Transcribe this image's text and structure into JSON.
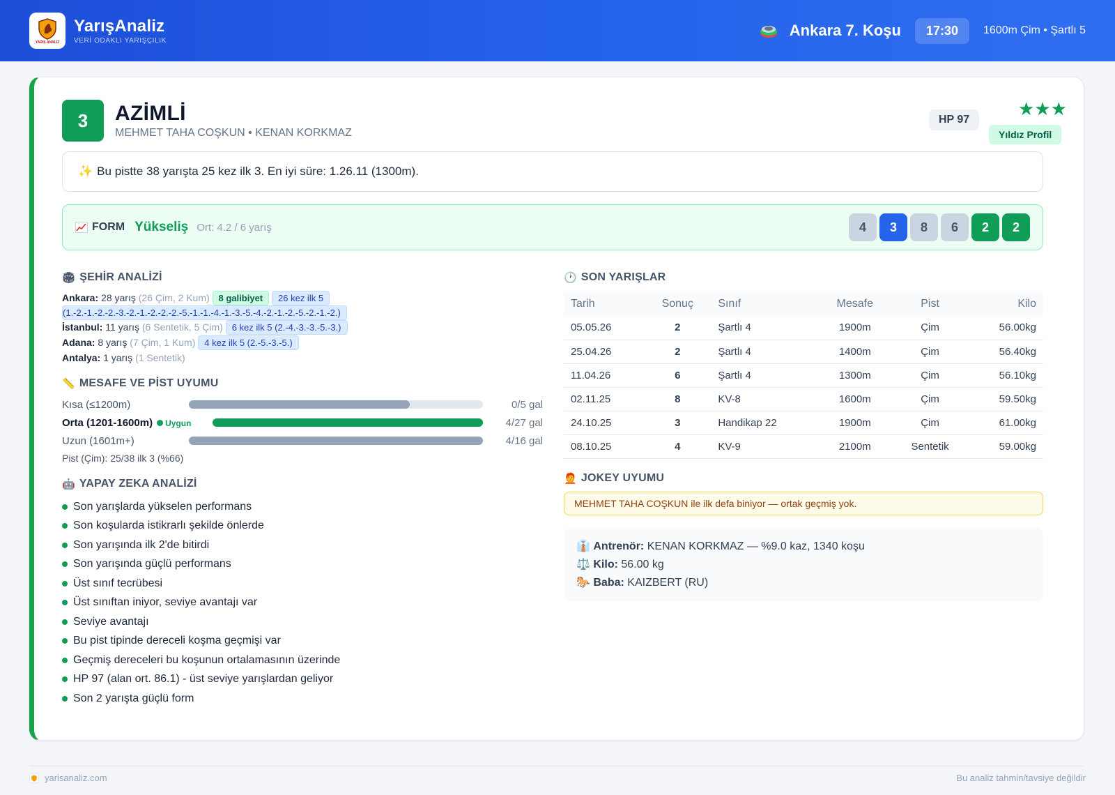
{
  "header": {
    "brand_title": "YarışAnaliz",
    "brand_sub": "VERİ ODAKLI YARIŞÇILIK",
    "logo_text": "YARIŞ ANALİZ",
    "race_title": "Ankara 7. Koşu",
    "race_time": "17:30",
    "race_meta": "1600m Çim • Şartlı 5"
  },
  "horse": {
    "number": "3",
    "name": "AZİMLİ",
    "people": "MEHMET TAHA COŞKUN • KENAN KORKMAZ",
    "hp": "HP 97",
    "stars": "★★★",
    "profile": "Yıldız Profil",
    "highlight": "Bu pistte 38 yarışta 25 kez ilk 3. En iyi süre: 1.26.11 (1300m).",
    "highlight_icon": "sparkles-icon"
  },
  "form": {
    "label": "FORM",
    "trend": "Yükseliş",
    "avg": "Ort: 4.2 / 6 yarış",
    "results": [
      {
        "value": "4",
        "bg": "#cbd5e1",
        "fg": "#475569"
      },
      {
        "value": "3",
        "bg": "#2563eb",
        "fg": "#ffffff"
      },
      {
        "value": "8",
        "bg": "#cbd5e1",
        "fg": "#475569"
      },
      {
        "value": "6",
        "bg": "#cbd5e1",
        "fg": "#475569"
      },
      {
        "value": "2",
        "bg": "#0f9d58",
        "fg": "#ffffff"
      },
      {
        "value": "2",
        "bg": "#0f9d58",
        "fg": "#ffffff"
      }
    ]
  },
  "city": {
    "title": "ŞEHİR ANALİZİ",
    "rows": [
      {
        "city": "Ankara:",
        "count": "28 yarış",
        "detail": "(26 Çim, 2 Kum)",
        "tag_green": "8 galibiyet",
        "tag_blue": "26 kez ilk 5",
        "tag_blue_cont": "(1.-2.-1.-2.-2.-3.-2.-1.-2.-2.-2.-5.-1.-1.-4.-1.-3.-5.-4.-2.-1.-2.-5.-2.-1.-2.)"
      },
      {
        "city": "İstanbul:",
        "count": "11 yarış",
        "detail": "(6 Sentetik, 5 Çim)",
        "tag_blue": "6 kez ilk 5 (2.-4.-3.-3.-5.-3.)"
      },
      {
        "city": "Adana:",
        "count": "8 yarış",
        "detail": "(7 Çim, 1 Kum)",
        "tag_blue": "4 kez ilk 5 (2.-5.-3.-5.)"
      },
      {
        "city": "Antalya:",
        "count": "1 yarış",
        "detail": "(1 Sentetik)"
      }
    ]
  },
  "distance": {
    "title": "MESAFE VE PİST UYUMU",
    "rows": [
      {
        "label": "Kısa (≤1200m)",
        "value": "0/5 gal",
        "fill": 0.75,
        "color": "#94a3b8"
      },
      {
        "label": "Orta (1201-1600m)",
        "ok": "Uygun",
        "value": "4/27 gal",
        "fill": 1.0,
        "color": "#0f9d58"
      },
      {
        "label": "Uzun (1601m+)",
        "value": "4/16 gal",
        "fill": 1.0,
        "color": "#94a3b8"
      }
    ],
    "pist": "Pist (Çim): 25/38 ilk 3 (%66)"
  },
  "ai": {
    "title": "YAPAY ZEKA ANALİZİ",
    "items": [
      "Son yarışlarda yükselen performans",
      "Son koşularda istikrarlı şekilde önlerde",
      "Son yarışında ilk 2'de bitirdi",
      "Son yarışında güçlü performans",
      "Üst sınıf tecrübesi",
      "Üst sınıftan iniyor, seviye avantajı var",
      "Seviye avantajı",
      "Bu pist tipinde dereceli koşma geçmişi var",
      "Geçmiş dereceleri bu koşunun ortalamasının üzerinde",
      "HP 97 (alan ort. 86.1) - üst seviye yarışlardan geliyor",
      "Son 2 yarışta güçlü form"
    ]
  },
  "races": {
    "title": "SON YARIŞLAR",
    "columns": [
      "Tarih",
      "Sonuç",
      "Sınıf",
      "Mesafe",
      "Pist",
      "Kilo"
    ],
    "rows": [
      {
        "date": "05.05.26",
        "pos": "2",
        "hl": true,
        "cls": "Şartlı 4",
        "dist": "1900m",
        "track": "Çim",
        "kg": "56.00kg"
      },
      {
        "date": "25.04.26",
        "pos": "2",
        "hl": true,
        "cls": "Şartlı 4",
        "dist": "1400m",
        "track": "Çim",
        "kg": "56.40kg"
      },
      {
        "date": "11.04.26",
        "pos": "6",
        "hl": false,
        "cls": "Şartlı 4",
        "dist": "1300m",
        "track": "Çim",
        "kg": "56.10kg"
      },
      {
        "date": "02.11.25",
        "pos": "8",
        "hl": false,
        "cls": "KV-8",
        "dist": "1600m",
        "track": "Çim",
        "kg": "59.50kg"
      },
      {
        "date": "24.10.25",
        "pos": "3",
        "hl": true,
        "cls": "Handikap 22",
        "dist": "1900m",
        "track": "Çim",
        "kg": "61.00kg"
      },
      {
        "date": "08.10.25",
        "pos": "4",
        "hl": false,
        "cls": "KV-9",
        "dist": "2100m",
        "track": "Sentetik",
        "kg": "59.00kg"
      }
    ]
  },
  "jokey": {
    "title": "JOKEY UYUMU",
    "text": "MEHMET TAHA COŞKUN ile ilk defa biniyor — ortak geçmiş yok."
  },
  "info": {
    "trainer_label": "Antrenör:",
    "trainer": "KENAN KORKMAZ — %9.0 kaz, 1340 koşu",
    "kilo_label": "Kilo:",
    "kilo": "56.00 kg",
    "baba_label": "Baba:",
    "baba": "KAIZBERT (RU)"
  },
  "footer": {
    "site": "yarisanaliz.com",
    "disclaimer": "Bu analiz tahmin/tavsiye değildir"
  }
}
